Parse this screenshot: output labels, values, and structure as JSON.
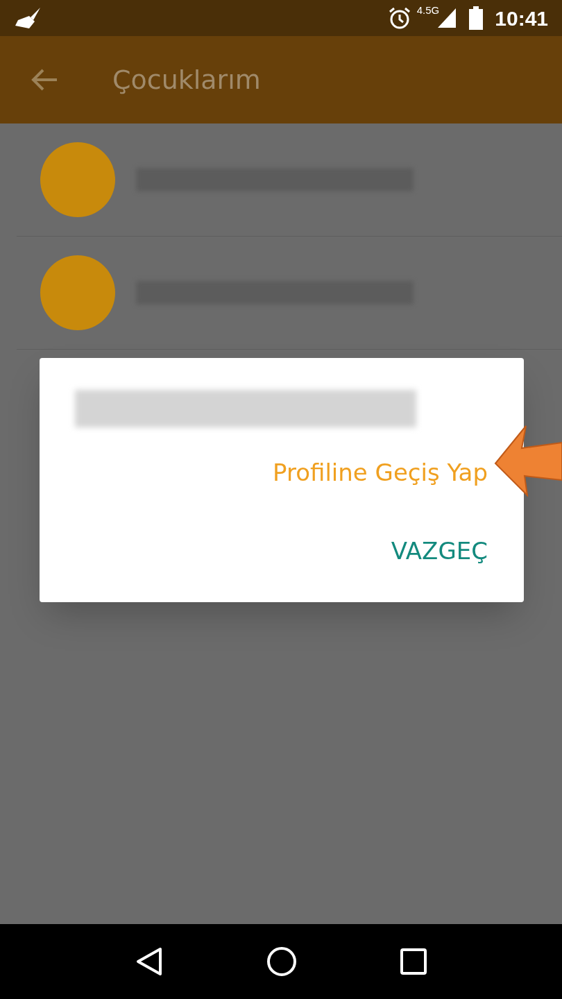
{
  "status_bar": {
    "network": "4.5G",
    "time": "10:41"
  },
  "app_bar": {
    "title": "Çocuklarım"
  },
  "children": [
    {
      "kind": "redacted"
    },
    {
      "kind": "redacted"
    }
  ],
  "dialog": {
    "kind": "redacted",
    "actions": [
      {
        "label": "Profiline Geçiş Yap",
        "kind": "link"
      },
      {
        "label": "VAZGEÇ",
        "kind": "button"
      }
    ]
  },
  "annotation": {
    "kind": "arrow"
  }
}
